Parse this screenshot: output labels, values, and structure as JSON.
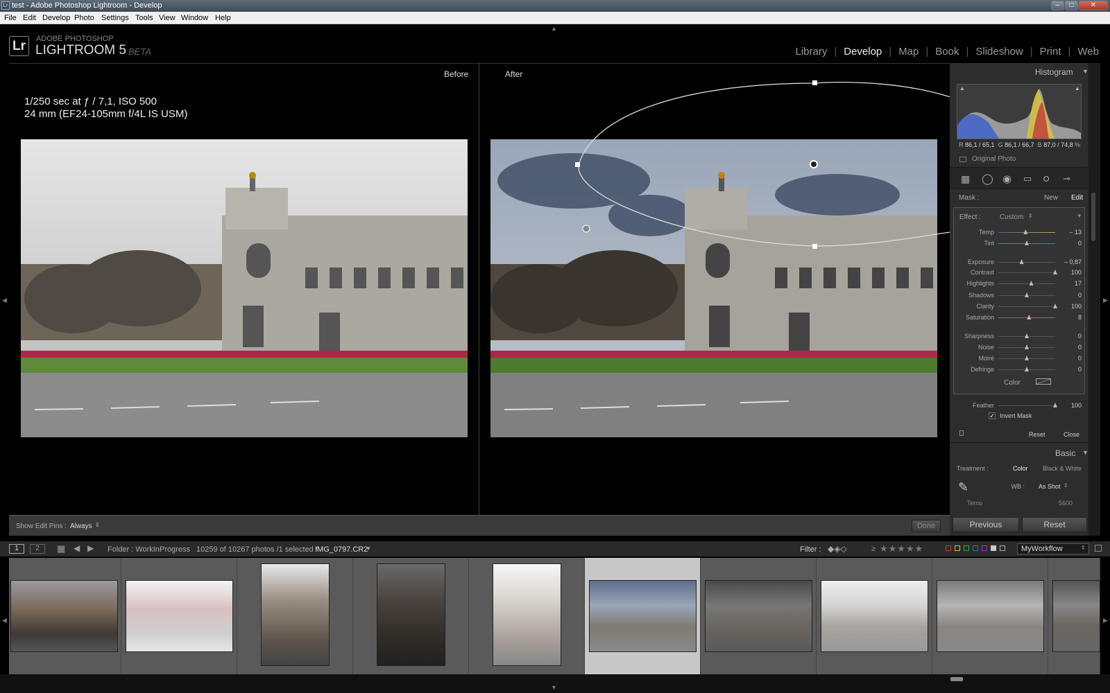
{
  "window": {
    "title": "test - Adobe Photoshop Lightroom - Develop",
    "app_badge": "Lr"
  },
  "menu": [
    "File",
    "Edit",
    "Develop",
    "Photo",
    "Settings",
    "Tools",
    "View",
    "Window",
    "Help"
  ],
  "brand": {
    "line1": "ADOBE PHOTOSHOP",
    "line2": "LIGHTROOM 5",
    "line3": "BETA",
    "logo": "Lr"
  },
  "modules": [
    "Library",
    "Develop",
    "Map",
    "Book",
    "Slideshow",
    "Print",
    "Web"
  ],
  "active_module": "Develop",
  "view": {
    "before_label": "Before",
    "after_label": "After",
    "exif_line1": "1/250 sec at ƒ / 7,1, ISO 500",
    "exif_line2": "24 mm (EF24-105mm f/4L IS USM)"
  },
  "toolbar": {
    "edit_pins_label": "Show Edit Pins :",
    "edit_pins_value": "Always",
    "done_label": "Done"
  },
  "histogram": {
    "title": "Histogram",
    "r_label": "R",
    "r_value": "86,1 / 65,1",
    "g_label": "G",
    "g_value": "86,1 / 66,7",
    "b_label": "B",
    "b_value": "87,0 / 74,8",
    "pct": "%",
    "original_photo": "Original Photo"
  },
  "mask": {
    "label": "Mask :",
    "new": "New",
    "edit": "Edit",
    "effect_label": "Effect :",
    "effect_value": "Custom",
    "sliders": [
      {
        "label": "Temp",
        "value": "– 13",
        "pos": 0.48
      },
      {
        "label": "Tint",
        "value": "0",
        "pos": 0.5
      },
      {
        "label": "Exposure",
        "value": "– 0,87",
        "pos": 0.41
      },
      {
        "label": "Contrast",
        "value": "100",
        "pos": 1.0
      },
      {
        "label": "Highlights",
        "value": "17",
        "pos": 0.58
      },
      {
        "label": "Shadows",
        "value": "0",
        "pos": 0.5
      },
      {
        "label": "Clarity",
        "value": "100",
        "pos": 1.0
      },
      {
        "label": "Saturation",
        "value": "8",
        "pos": 0.54
      },
      {
        "label": "Sharpness",
        "value": "0",
        "pos": 0.5
      },
      {
        "label": "Noise",
        "value": "0",
        "pos": 0.5
      },
      {
        "label": "Moiré",
        "value": "0",
        "pos": 0.5
      },
      {
        "label": "Defringe",
        "value": "0",
        "pos": 0.5
      }
    ],
    "color_label": "Color",
    "feather_label": "Feather",
    "feather_value": "100",
    "feather_pos": 1.0,
    "invert_label": "Invert Mask",
    "reset": "Reset",
    "close": "Close"
  },
  "basic": {
    "title": "Basic",
    "treatment_label": "Treatment :",
    "treatment_color": "Color",
    "treatment_bw": "Black & White",
    "wb_label": "WB :",
    "wb_value": "As Shot",
    "temp_label": "Temp",
    "temp_value": "5600"
  },
  "nav": {
    "previous": "Previous",
    "reset": "Reset"
  },
  "filmstrip_bar": {
    "page1": "1",
    "page2": "2",
    "folder": "Folder : WorkInProgress",
    "count": "10259 of 10267 photos /1 selected /",
    "filename": "IMG_0797.CR2",
    "filter_label": "Filter :",
    "rating_op": "≥",
    "preset": "MyWorkflow"
  },
  "colors": {
    "accent": "#dddddd",
    "panel": "#2d2d2d",
    "selected_thumb": "#c8c8c8"
  }
}
